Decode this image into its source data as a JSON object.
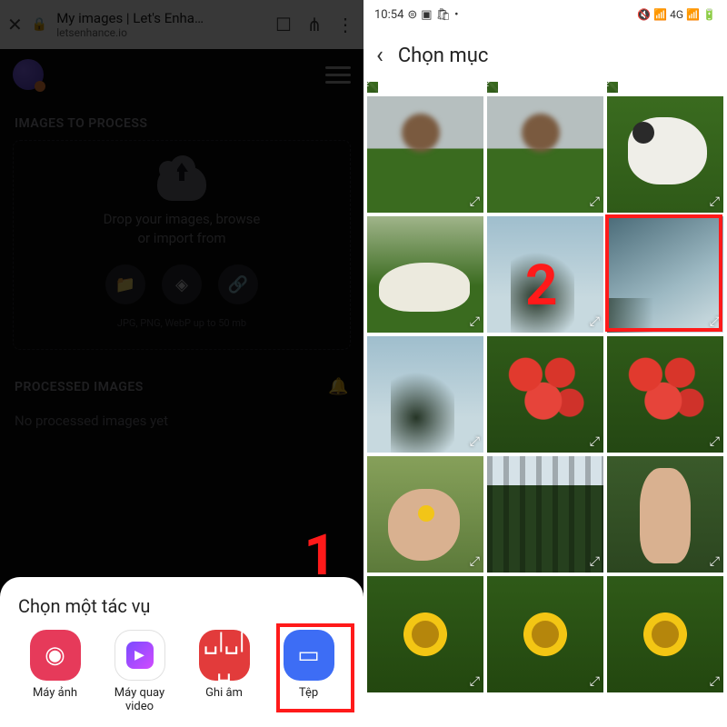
{
  "left": {
    "browser": {
      "title": "My images | Let's Enha…",
      "host": "letsenhance.io"
    },
    "sections": {
      "to_process": "IMAGES TO PROCESS",
      "processed": "PROCESSED IMAGES"
    },
    "dropzone": {
      "line1": "Drop your images, browse",
      "line2": "or import from",
      "hint": "JPG, PNG, WebP up to 50 mb"
    },
    "processed_empty": "No processed images yet",
    "sheet": {
      "title": "Chọn một tác vụ",
      "items": [
        {
          "label": "Máy ảnh"
        },
        {
          "label": "Máy quay video"
        },
        {
          "label": "Ghi âm"
        },
        {
          "label": "Tệp"
        }
      ]
    },
    "callout": "1"
  },
  "right": {
    "status": {
      "time": "10:54",
      "network": "4G"
    },
    "header": {
      "title": "Chọn mục"
    },
    "callout": "2"
  }
}
